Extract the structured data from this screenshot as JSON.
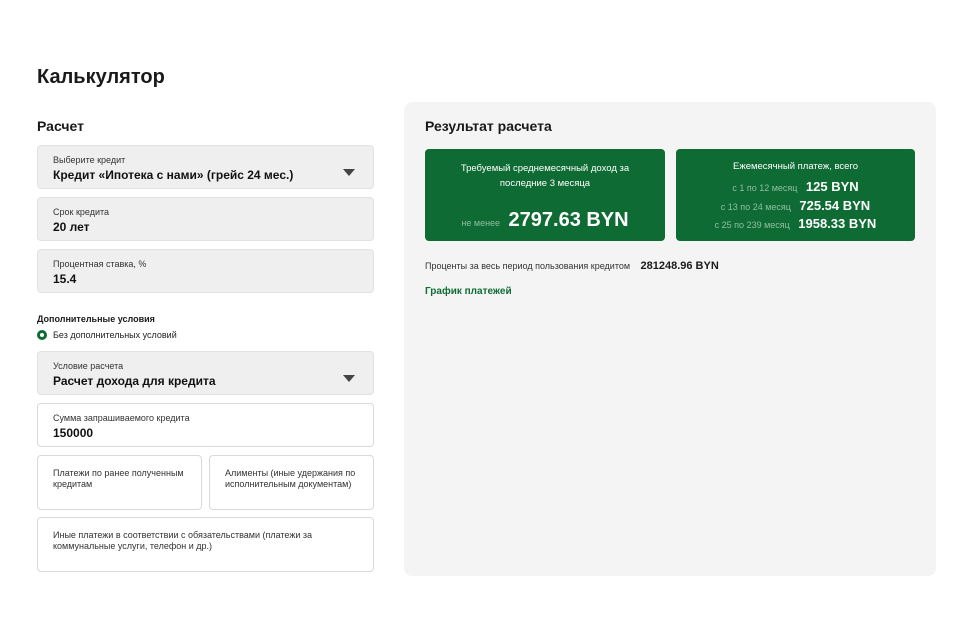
{
  "page": {
    "title": "Калькулятор"
  },
  "calculation": {
    "title": "Расчет",
    "credit_select": {
      "label": "Выберите кредит",
      "value": "Кредит «Ипотека с нами» (грейс 24 мес.)"
    },
    "term": {
      "label": "Срок кредита",
      "value": "20 лет"
    },
    "rate": {
      "label": "Процентная ставка, %",
      "value": "15.4"
    }
  },
  "additional": {
    "title": "Дополнительные условия",
    "radio_label": "Без дополнительных условий",
    "condition_select": {
      "label": "Условие расчета",
      "value": "Расчет дохода для кредита"
    },
    "amount": {
      "label": "Сумма запрашиваемого кредита",
      "value": "150000"
    },
    "prior_payments": {
      "label": "Платежи по ранее полученным кредитам",
      "value": ""
    },
    "alimony": {
      "label": "Алименты (иные удержания по исполнительным документам)",
      "value": ""
    },
    "other_payments": {
      "label": "Иные платежи в соответствии с обязательствами (платежи за коммунальные услуги, телефон и др.)",
      "value": ""
    }
  },
  "result": {
    "title": "Результат расчета",
    "income_card": {
      "title": "Требуемый среднемесячный доход за последние 3 месяца",
      "prefix": "не менее",
      "value": "2797.63 BYN"
    },
    "payment_card": {
      "title": "Ежемесячный платеж, всего",
      "rows": [
        {
          "period": "с 1 по 12 месяц",
          "amount": "125 BYN"
        },
        {
          "period": "с 13 по 24 месяц",
          "amount": "725.54 BYN"
        },
        {
          "period": "с 25 по 239 месяц",
          "amount": "1958.33 BYN"
        }
      ]
    },
    "interest_label": "Проценты за весь период пользования кредитом",
    "interest_value": "281248.96 BYN",
    "schedule_link": "График платежей"
  },
  "colors": {
    "accent": "#0f6b34",
    "panel": "#f4f4f4",
    "field": "#efefef"
  },
  "icons": {
    "dropdown": "chevron-down-icon",
    "radio": "radio-selected-icon"
  }
}
